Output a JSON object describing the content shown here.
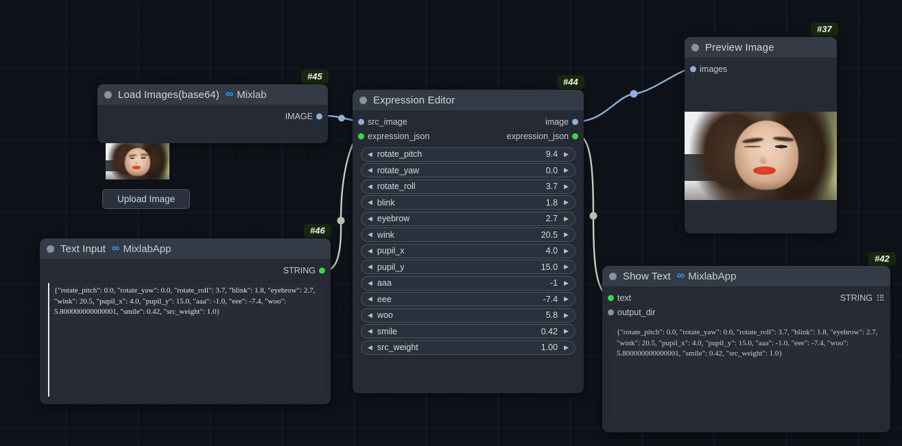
{
  "canvas": {
    "background_color": "#0e1118",
    "grid_line_color": "#1c2230"
  },
  "nodes": {
    "load_images": {
      "id_badge": "#45",
      "title": "Load Images(base64)",
      "suffix": "Mixlab",
      "outputs": [
        {
          "label": "IMAGE",
          "type": "IMAGE",
          "color": "#8eb0d8"
        }
      ],
      "button_label": "Upload Image",
      "thumbnail_alt": "portrait-thumbnail"
    },
    "expression_editor": {
      "id_badge": "#44",
      "title": "Expression Editor",
      "inputs": [
        {
          "label": "src_image",
          "type": "IMAGE",
          "color": "#8eb0d8"
        },
        {
          "label": "expression_json",
          "type": "STRING",
          "color": "#3dd44a"
        }
      ],
      "outputs": [
        {
          "label": "image",
          "type": "IMAGE",
          "color": "#8eb0d8"
        },
        {
          "label": "expression_json",
          "type": "STRING",
          "color": "#3dd44a"
        }
      ],
      "widgets": [
        {
          "label": "rotate_pitch",
          "value": "9.4"
        },
        {
          "label": "rotate_yaw",
          "value": "0.0"
        },
        {
          "label": "rotate_roll",
          "value": "3.7"
        },
        {
          "label": "blink",
          "value": "1.8"
        },
        {
          "label": "eyebrow",
          "value": "2.7"
        },
        {
          "label": "wink",
          "value": "20.5"
        },
        {
          "label": "pupil_x",
          "value": "4.0"
        },
        {
          "label": "pupil_y",
          "value": "15.0"
        },
        {
          "label": "aaa",
          "value": "-1"
        },
        {
          "label": "eee",
          "value": "-7.4"
        },
        {
          "label": "woo",
          "value": "5.8"
        },
        {
          "label": "smile",
          "value": "0.42"
        },
        {
          "label": "src_weight",
          "value": "1.00"
        }
      ],
      "arrow_left": "◀",
      "arrow_right": "▶"
    },
    "text_input": {
      "id_badge": "#46",
      "title": "Text Input",
      "suffix": "MixlabApp",
      "outputs": [
        {
          "label": "STRING",
          "type": "STRING",
          "color": "#3dd44a"
        }
      ],
      "text_value": "{\"rotate_pitch\": 0.0, \"rotate_yaw\": 0.0, \"rotate_roll\": 3.7, \"blink\": 1.8, \"eyebrow\": 2.7, \"wink\": 20.5, \"pupil_x\": 4.0, \"pupil_y\": 15.0, \"aaa\": -1.0, \"eee\": -7.4, \"woo\": 5.800000000000001, \"smile\": 0.42, \"src_weight\": 1.0}"
    },
    "preview_image": {
      "id_badge": "#37",
      "title": "Preview Image",
      "inputs": [
        {
          "label": "images",
          "type": "IMAGE",
          "color": "#8eb0d8"
        }
      ],
      "image_alt": "winking-portrait-preview"
    },
    "show_text": {
      "id_badge": "#42",
      "title": "Show Text",
      "suffix": "MixlabApp",
      "inputs": [
        {
          "label": "text",
          "type": "STRING",
          "color": "#3dd44a"
        },
        {
          "label": "output_dir",
          "type": "STRING",
          "color": "#8d919b"
        }
      ],
      "outputs": [
        {
          "label": "STRING",
          "type": "STRING",
          "icon": "grid-icon"
        }
      ],
      "text_value": "{\"rotate_pitch\": 0.0, \"rotate_yaw\": 0.0, \"rotate_roll\": 3.7, \"blink\": 1.8, \"eyebrow\": 2.7, \"wink\": 20.5, \"pupil_x\": 4.0, \"pupil_y\": 15.0, \"aaa\": -1.0, \"eee\": -7.4, \"woo\": 5.800000000000001, \"smile\": 0.42, \"src_weight\": 1.0}"
    }
  },
  "links": [
    {
      "from": "load_images.IMAGE",
      "to": "expression_editor.src_image",
      "color": "#8eb0d8"
    },
    {
      "from": "text_input.STRING",
      "to": "expression_editor.expression_json",
      "color": "#c5cfbc"
    },
    {
      "from": "expression_editor.image",
      "to": "preview_image.images",
      "color": "#8eb0d8"
    },
    {
      "from": "expression_editor.expression_json",
      "to": "show_text.text",
      "color": "#c5cfbc"
    }
  ]
}
